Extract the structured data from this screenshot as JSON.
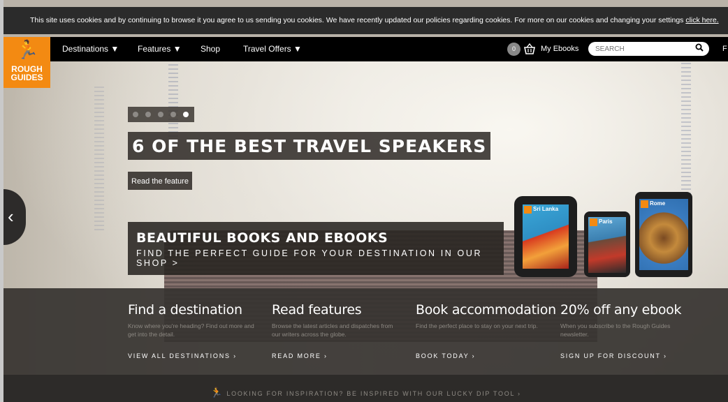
{
  "cookie_bar": {
    "text": "This site uses cookies and by continuing to browse it you agree to us sending you cookies. We have recently updated our policies regarding cookies. For more on our cookies and changing your settings ",
    "link": "click here."
  },
  "logo": {
    "line1": "ROUGH",
    "line2": "GUIDES"
  },
  "nav": {
    "items": [
      "Destinations ▼",
      "Features ▼",
      "Shop",
      "Travel Offers ▼"
    ],
    "basket_count": "0",
    "my_ebooks": "My Ebooks",
    "search_placeholder": "SEARCH",
    "trailing": "F"
  },
  "slider": {
    "dot_count": 5,
    "active_dot": 5,
    "title": "6 OF THE BEST TRAVEL SPEAKERS",
    "link": "Read the feature"
  },
  "promo": {
    "title": "BEAUTIFUL BOOKS AND EBOOKS",
    "subtitle": "FIND THE PERFECT GUIDE FOR YOUR DESTINATION IN OUR SHOP >",
    "covers": [
      "Sri Lanka",
      "Paris",
      "Rome"
    ]
  },
  "features": [
    {
      "title": "Find a destination",
      "desc": "Know where you're heading? Find out more and get into the detail.",
      "link": "VIEW ALL DESTINATIONS ›"
    },
    {
      "title": "Read features",
      "desc": "Browse the latest articles and dispatches from our writers across the globe.",
      "link": "READ MORE ›"
    },
    {
      "title": "Book accommodation",
      "desc": "Find the perfect place to stay on your next trip.",
      "link": "BOOK TODAY ›"
    },
    {
      "title": "20% off any ebook",
      "desc": "When you subscribe to the Rough Guides newsletter.",
      "link": "SIGN UP FOR DISCOUNT ›"
    }
  ],
  "inspiration": "LOOKING FOR INSPIRATION? BE INSPIRED WITH OUR LUCKY DIP TOOL ›",
  "icons": {
    "runner": "runner-icon",
    "basket": "basket-icon",
    "search": "search-icon",
    "prev": "chevron-left-icon"
  },
  "colors": {
    "brand_orange": "#f38a12",
    "nav_bg": "#000000",
    "panel": "#37342f"
  }
}
